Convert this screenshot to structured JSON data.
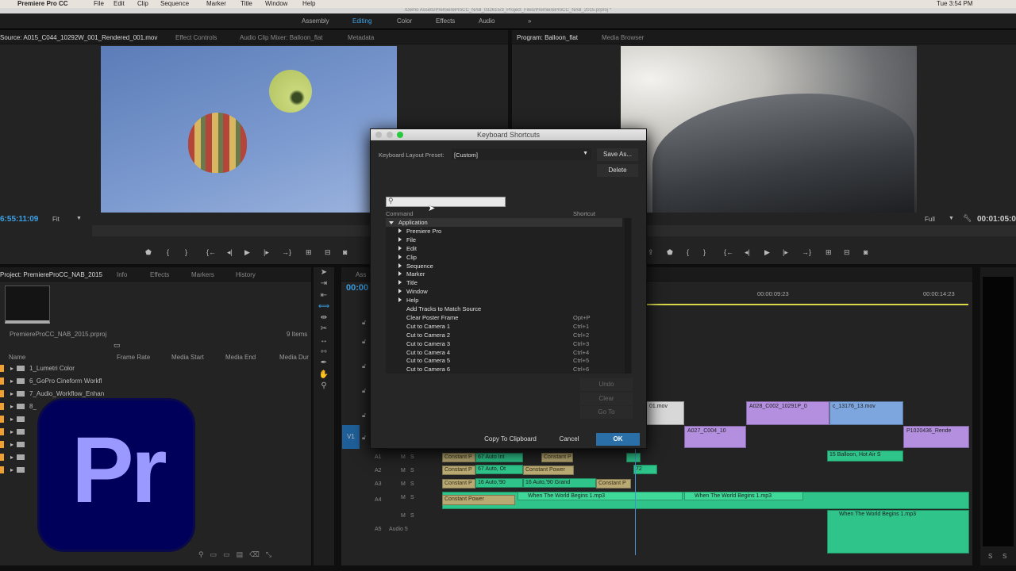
{
  "menubar": {
    "app": "Premiere Pro CC",
    "items": [
      "File",
      "Edit",
      "Clip",
      "Sequence",
      "Marker",
      "Title",
      "Window",
      "Help"
    ],
    "clock": "Tue 3:54 PM"
  },
  "titlebar": {
    "path": "/Demo Assets/PremiereProCC_NAB_032615/3_Project_Files/PremiereProCC_NAB_2015.prproj *"
  },
  "workspaces": {
    "items": [
      "Assembly",
      "Editing",
      "Color",
      "Effects",
      "Audio"
    ],
    "active": "Editing",
    "more": "»"
  },
  "source": {
    "tabs": [
      "Source: A015_C044_10292W_001_Rendered_001.mov",
      "Effect Controls",
      "Audio Clip Mixer: Balloon_flat",
      "Metadata"
    ],
    "timecode": "6:55:11:09",
    "zoom": "Fit"
  },
  "program": {
    "tabs": [
      "Program: Balloon_flat",
      "Media Browser"
    ],
    "quality": "Full",
    "timecode": "00:01:05:0"
  },
  "project": {
    "tabs": [
      "Project: PremiereProCC_NAB_2015",
      "Info",
      "Effects",
      "Markers",
      "History"
    ],
    "file": "PremiereProCC_NAB_2015.prproj",
    "count": "9 Items",
    "columns": [
      "Name",
      "Frame Rate",
      "Media Start",
      "Media End",
      "Media Dur"
    ],
    "items": [
      "1_Lumetri Color",
      "6_GoPro Cineform Workfl",
      "7_Audio_Workflow_Enhan",
      "8_",
      "",
      "",
      "",
      "",
      ""
    ]
  },
  "dialog": {
    "title": "Keyboard Shortcuts",
    "preset_label": "Keyboard Layout Preset:",
    "preset_value": "[Custom]",
    "save_as": "Save As...",
    "delete": "Delete",
    "search_placeholder": "",
    "col_command": "Command",
    "col_shortcut": "Shortcut",
    "rows": [
      {
        "label": "Application",
        "level": 0,
        "expander": "open",
        "shortcut": ""
      },
      {
        "label": "Premiere Pro",
        "level": 1,
        "expander": "closed",
        "shortcut": ""
      },
      {
        "label": "File",
        "level": 1,
        "expander": "closed",
        "shortcut": ""
      },
      {
        "label": "Edit",
        "level": 1,
        "expander": "closed",
        "shortcut": ""
      },
      {
        "label": "Clip",
        "level": 1,
        "expander": "closed",
        "shortcut": ""
      },
      {
        "label": "Sequence",
        "level": 1,
        "expander": "closed",
        "shortcut": ""
      },
      {
        "label": "Marker",
        "level": 1,
        "expander": "closed",
        "shortcut": ""
      },
      {
        "label": "Title",
        "level": 1,
        "expander": "closed",
        "shortcut": ""
      },
      {
        "label": "Window",
        "level": 1,
        "expander": "closed",
        "shortcut": ""
      },
      {
        "label": "Help",
        "level": 1,
        "expander": "closed",
        "shortcut": ""
      },
      {
        "label": "Add Tracks to Match Source",
        "level": 1,
        "expander": "none",
        "shortcut": ""
      },
      {
        "label": "Clear Poster Frame",
        "level": 1,
        "expander": "none",
        "shortcut": "Opt+P"
      },
      {
        "label": "Cut to Camera 1",
        "level": 1,
        "expander": "none",
        "shortcut": "Ctrl+1"
      },
      {
        "label": "Cut to Camera 2",
        "level": 1,
        "expander": "none",
        "shortcut": "Ctrl+2"
      },
      {
        "label": "Cut to Camera 3",
        "level": 1,
        "expander": "none",
        "shortcut": "Ctrl+3"
      },
      {
        "label": "Cut to Camera 4",
        "level": 1,
        "expander": "none",
        "shortcut": "Ctrl+4"
      },
      {
        "label": "Cut to Camera 5",
        "level": 1,
        "expander": "none",
        "shortcut": "Ctrl+5"
      },
      {
        "label": "Cut to Camera 6",
        "level": 1,
        "expander": "none",
        "shortcut": "Ctrl+6"
      }
    ],
    "undo": "Undo",
    "clear": "Clear",
    "goto": "Go To",
    "copy": "Copy To Clipboard",
    "cancel": "Cancel",
    "ok": "OK"
  },
  "timeline": {
    "tab_partial": "Ass",
    "timecode": "00:00",
    "ruler": [
      "00:00:09:23",
      "00:00:14:23"
    ],
    "tracks": {
      "v1": "V1",
      "a1": "A1",
      "a2": "A2",
      "a3": "A3",
      "a4": "A4",
      "a5": "A5",
      "a5_name": "Audio 5",
      "m": "M",
      "s": "S"
    },
    "clips": {
      "c1": "01.mov",
      "c2": "A028_C002_10291P_0",
      "c3": "c_13176_13.mov",
      "c4": "A027_C004_10",
      "c5": "P1020436_Rende",
      "c6": "Constant P",
      "c7": "67 Auto Int",
      "c8": "Constant P",
      "c9": "15 Balloon, Hot Air S",
      "c10": "Constant P",
      "c11": "67 Auto, Ot",
      "c12": "Constant Power",
      "c13": "72",
      "c14": "Constant P",
      "c15": "16 Auto,'90",
      "c16": "16 Auto,'90 Grand",
      "c17": "Constant P",
      "c18": "Constant Power",
      "c19": "When The World Begins 1.mp3",
      "c20": "When The World Begins 1.mp3",
      "c21": "When The World Begins 1.mp3"
    }
  },
  "meters": {
    "s1": "S",
    "s2": "S"
  },
  "logo": {
    "text": "Pr"
  },
  "colors": {
    "accent": "#3ca0e6",
    "ok": "#2a6fa8",
    "video_clip": "#b48fe0",
    "audio_clip": "#2ec48a",
    "logo_bg": "#00005b",
    "logo_fg": "#9999ff"
  }
}
